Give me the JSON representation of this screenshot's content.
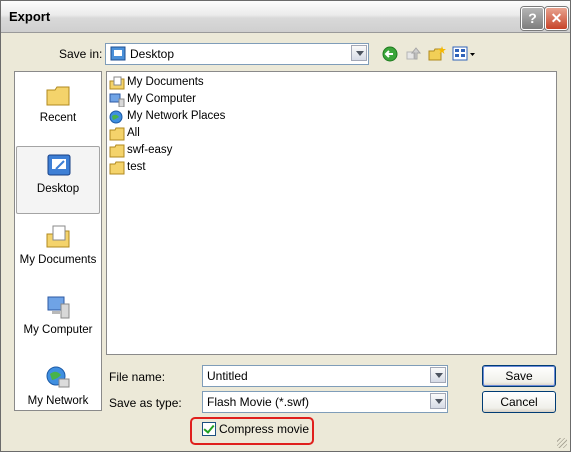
{
  "window": {
    "title": "Export"
  },
  "toolbar": {
    "save_in_label": "Save in:",
    "location": "Desktop"
  },
  "places": [
    {
      "label": "Recent"
    },
    {
      "label": "Desktop"
    },
    {
      "label": "My Documents"
    },
    {
      "label": "My Computer"
    },
    {
      "label": "My Network"
    }
  ],
  "files": [
    {
      "name": "My Documents",
      "icon": "my-documents-icon"
    },
    {
      "name": "My Computer",
      "icon": "my-computer-icon"
    },
    {
      "name": "My Network Places",
      "icon": "network-places-icon"
    },
    {
      "name": "All",
      "icon": "folder-icon"
    },
    {
      "name": "swf-easy",
      "icon": "folder-icon"
    },
    {
      "name": "test",
      "icon": "folder-icon"
    }
  ],
  "form": {
    "file_name_label": "File name:",
    "file_name_value": "Untitled",
    "save_type_label": "Save as type:",
    "save_type_value": "Flash Movie (*.swf)",
    "save_label": "Save",
    "cancel_label": "Cancel",
    "compress_label": "Compress movie",
    "compress_checked": true
  },
  "colors": {
    "highlight_border": "#e0201d",
    "check": "#21a121"
  }
}
